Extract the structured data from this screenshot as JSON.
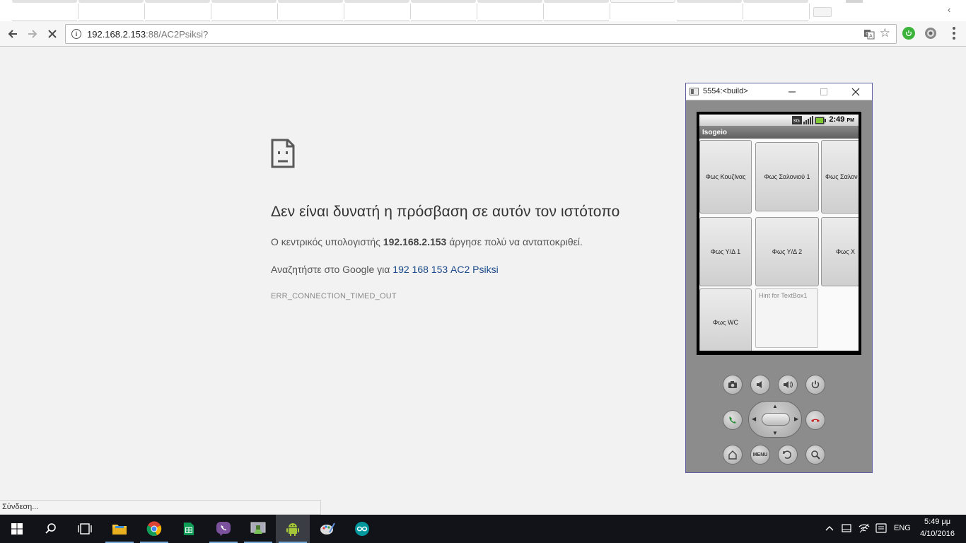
{
  "browser": {
    "url_host": "192.168.2.153",
    "url_rest": ":88/AC2Psiksi?",
    "status_text": "Σύνδεση..."
  },
  "error_page": {
    "title": "Δεν είναι δυνατή η πρόσβαση σε αυτόν τον ιστότοπο",
    "desc_prefix": "Ο κεντρικός υπολογιστής ",
    "desc_host": "192.168.2.153",
    "desc_suffix": " άργησε πολύ να ανταποκριθεί.",
    "search_prefix": "Αναζητήστε στο Google για ",
    "search_link": "192 168 153 AC2 Psiksi",
    "error_code": "ERR_CONNECTION_TIMED_OUT"
  },
  "emulator": {
    "window_title": "5554:<build>",
    "time": "2:49",
    "time_suffix": "PM",
    "network_badge": "3G",
    "app_title": "Isogeio",
    "buttons": [
      "Φως Κουζίνας",
      "Φως Σαλονιού 1",
      "Φως Σαλον",
      "Φως Υ/Δ 1",
      "Φως Υ/Δ 2",
      "Φως Χ",
      "Φως WC"
    ],
    "textbox_hint": "Hint for TextBox1",
    "menu_key": "MENU"
  },
  "taskbar": {
    "language": "ENG",
    "time": "5:49 μμ",
    "date": "4/10/2016"
  }
}
